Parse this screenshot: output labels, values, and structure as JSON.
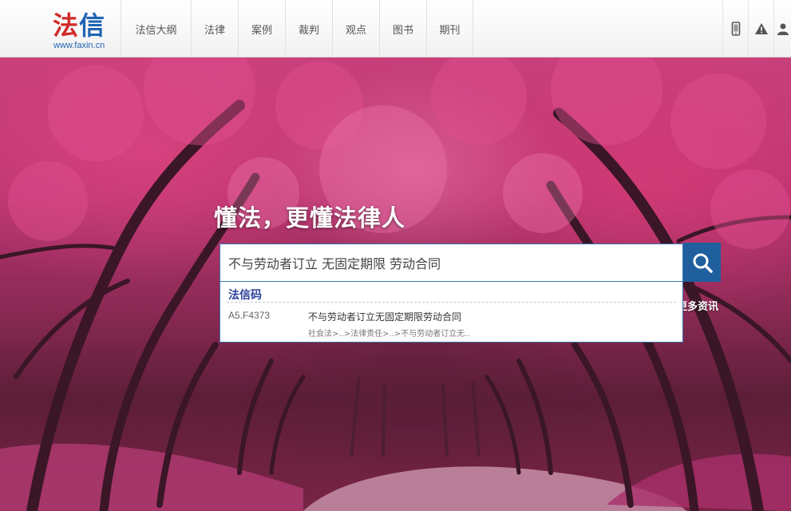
{
  "logo": {
    "cn_part1": "法",
    "cn_part2": "信",
    "url": "www.faxin.cn"
  },
  "nav": {
    "items": [
      {
        "label": "法信大纲"
      },
      {
        "label": "法律"
      },
      {
        "label": "案例"
      },
      {
        "label": "裁判"
      },
      {
        "label": "观点"
      },
      {
        "label": "图书"
      },
      {
        "label": "期刊"
      }
    ]
  },
  "tools": [
    "mobile-icon",
    "warning-icon",
    "user-icon"
  ],
  "hero": {
    "tagline": "懂法，更懂法律人"
  },
  "search": {
    "value": "不与劳动者订立 无固定期限 劳动合同",
    "button_icon": "search-icon"
  },
  "more_news": "更多资讯",
  "suggestions": {
    "header": "法信码",
    "items": [
      {
        "code": "A5.F4373",
        "title": "不与劳动者订立无固定期限劳动合同",
        "path": "社会法>..>法律责任>..>不与劳动者订立无.."
      }
    ]
  },
  "colors": {
    "brand_red": "#d12a2a",
    "brand_blue": "#1f63b3",
    "search_button": "#1f5f9e"
  }
}
